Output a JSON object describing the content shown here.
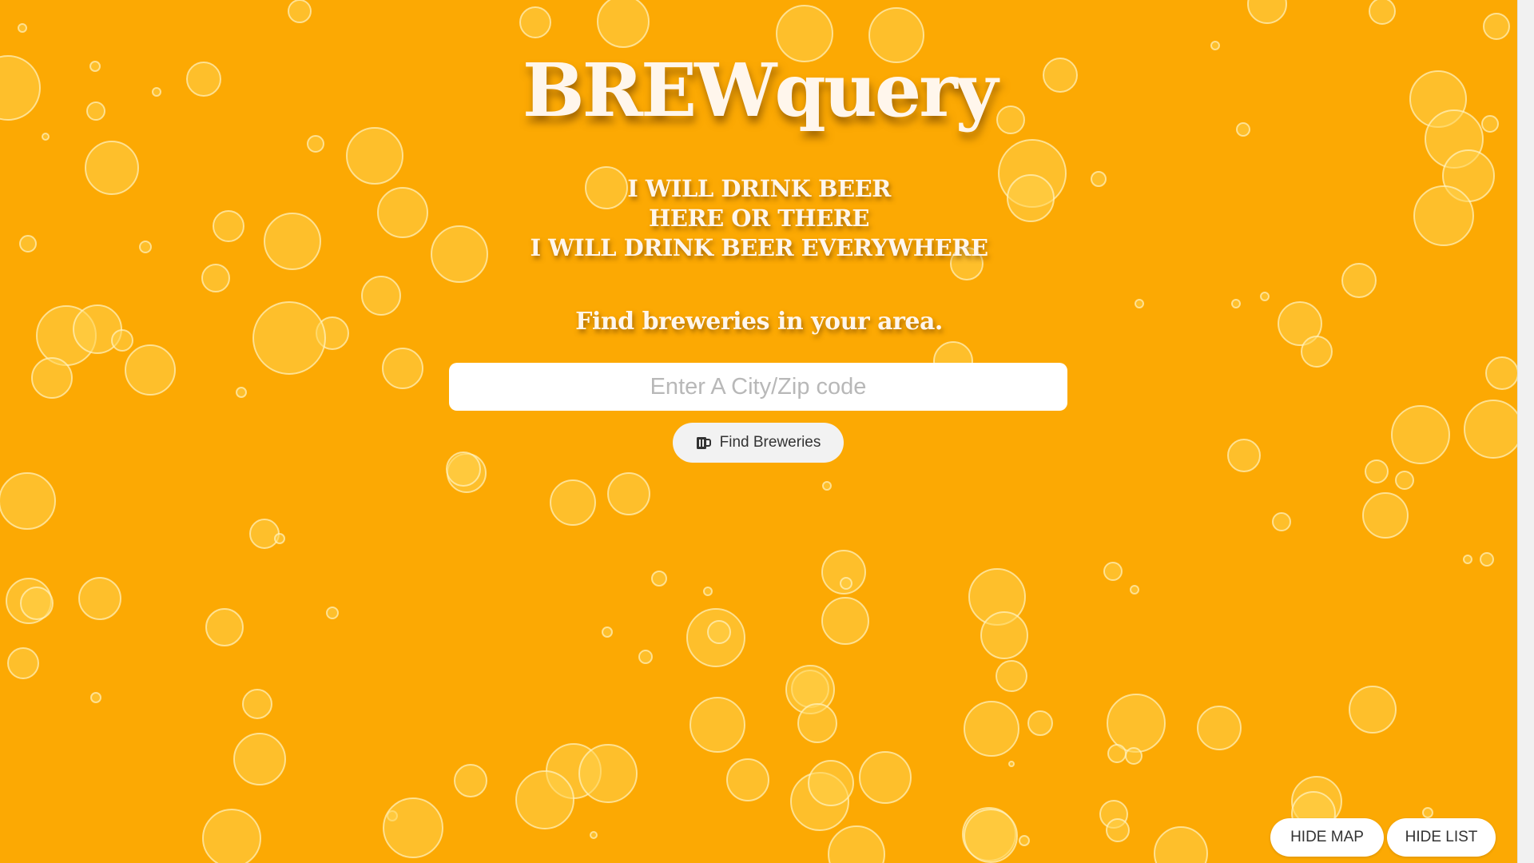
{
  "header": {
    "title": "BREWquery"
  },
  "tagline": {
    "line1": "I WILL DRINK BEER",
    "line2": "HERE OR THERE",
    "line3": "I WILL DRINK BEER EVERYWHERE"
  },
  "search": {
    "prompt": "Find breweries in your area.",
    "placeholder": "Enter A City/Zip code",
    "value": "",
    "button_label": "Find Breweries",
    "button_icon": "beer-mug-icon"
  },
  "toggles": {
    "hide_map_label": "HIDE MAP",
    "hide_list_label": "HIDE LIST"
  },
  "colors": {
    "background": "#fca903",
    "bubble": "#ffd24d",
    "title_text": "#fff6ec"
  }
}
